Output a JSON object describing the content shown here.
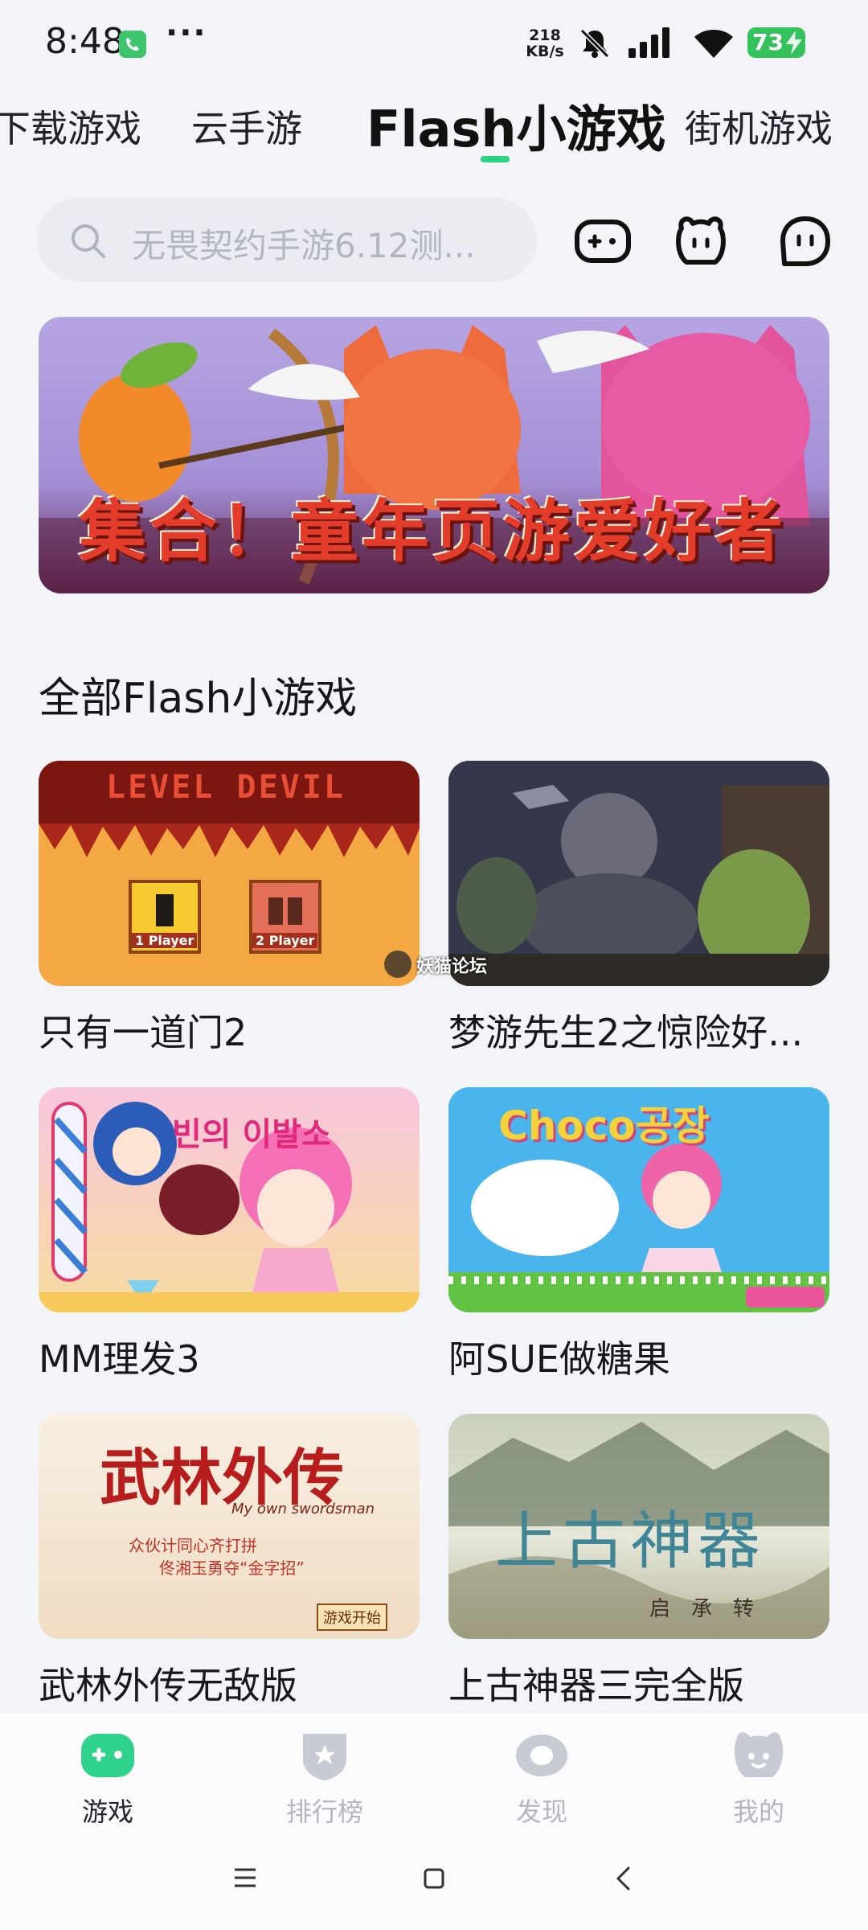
{
  "status_bar": {
    "time": "8:48",
    "more": "···",
    "net_speed_value": "218",
    "net_speed_unit": "KB/s",
    "battery": "73"
  },
  "tabs": [
    "下载游戏",
    "云手游",
    "Flash小游戏",
    "街机游戏"
  ],
  "active_tab": "Flash小游戏",
  "search": {
    "placeholder": "无畏契约手游6.12测..."
  },
  "banner": {
    "text": "集合！童年页游爱好者"
  },
  "section_title": "全部Flash小游戏",
  "games": [
    {
      "title": "只有一道门2",
      "thumb_text": "LEVEL DEVIL",
      "p1": "1 Player",
      "p2": "2 Player"
    },
    {
      "title": "梦游先生2之惊险好..."
    },
    {
      "title": "MM理发3",
      "thumb_text": "빈의 이발소"
    },
    {
      "title": "阿SUE做糖果",
      "thumb_text": "Choco공장"
    },
    {
      "title": "武林外传无敌版",
      "thumb_text": "武林外传",
      "thumb_sub": "My own swordsman",
      "thumb_line1": "众伙计同心齐打拼",
      "thumb_line2": "佟湘玉勇夺“金字招”",
      "start": "游戏开始"
    },
    {
      "title": "上古神器三完全版",
      "thumb_text": "上古神器",
      "thumb_sub": "启承转"
    }
  ],
  "watermark": "妖猫论坛",
  "bottom_nav": [
    {
      "label": "游戏",
      "icon": "gamepad-icon"
    },
    {
      "label": "排行榜",
      "icon": "ranking-shield-icon"
    },
    {
      "label": "发现",
      "icon": "discover-icon"
    },
    {
      "label": "我的",
      "icon": "profile-icon"
    }
  ],
  "colors": {
    "accent": "#2bd37f",
    "background": "#f3f4f8"
  }
}
